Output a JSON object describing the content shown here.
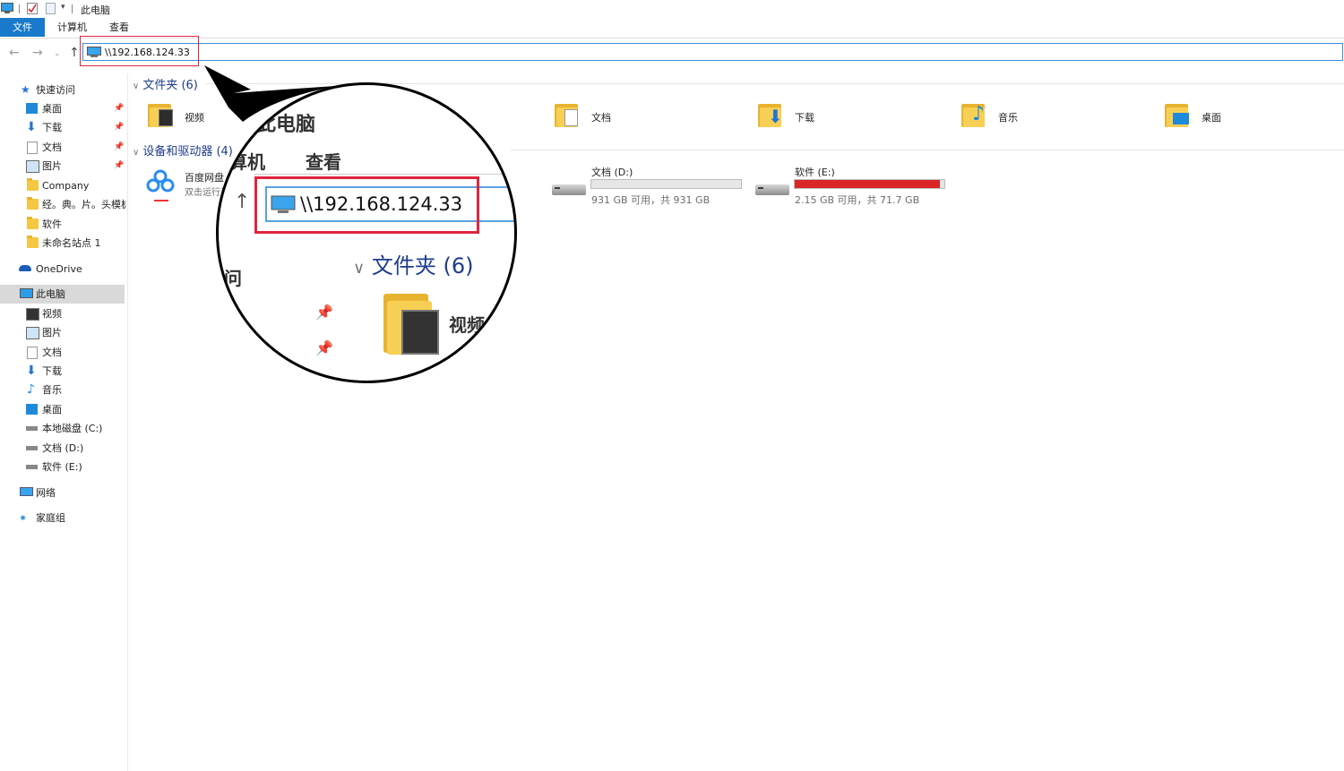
{
  "window": {
    "title": "此电脑"
  },
  "ribbon": {
    "tabs": [
      "文件",
      "计算机",
      "查看"
    ]
  },
  "address": {
    "path": "\\\\192.168.124.33"
  },
  "nav_pane": {
    "quick_access": "快速访问",
    "quick_items": [
      {
        "label": "桌面",
        "pinned": true
      },
      {
        "label": "下载",
        "pinned": true
      },
      {
        "label": "文档",
        "pinned": true
      },
      {
        "label": "图片",
        "pinned": true
      },
      {
        "label": "Company",
        "pinned": false
      },
      {
        "label": "经。典。片。头模板",
        "pinned": false
      },
      {
        "label": "软件",
        "pinned": false
      },
      {
        "label": "未命名站点 1",
        "pinned": false
      }
    ],
    "onedrive": "OneDrive",
    "this_pc": "此电脑",
    "pc_items": [
      "视频",
      "图片",
      "文档",
      "下载",
      "音乐",
      "桌面",
      "本地磁盘 (C:)",
      "文档 (D:)",
      "软件 (E:)"
    ],
    "network": "网络",
    "homegroup": "家庭组"
  },
  "main": {
    "folders_header": "文件夹 (6)",
    "folders": [
      "视频",
      "文档",
      "下载",
      "音乐",
      "桌面"
    ],
    "devices_header": "设备和驱动器 (4)",
    "baidu": {
      "name": "百度网盘",
      "sub": "双击运行百度网盘"
    },
    "drives": [
      {
        "name": "文档 (D:)",
        "free": "931 GB 可用，共 931 GB",
        "used_fraction": 0.0,
        "color": "#26a0da"
      },
      {
        "name": "软件 (E:)",
        "free": "2.15 GB 可用，共 71.7 GB",
        "used_fraction": 0.97,
        "color": "#da2626"
      }
    ]
  },
  "magnifier": {
    "title": "此电脑",
    "tab_computer": "计算机",
    "tab_view": "查看",
    "address": "\\\\192.168.124.33",
    "folders_header": "文件夹 (6)",
    "folder_label": "视频",
    "side_text": "问"
  }
}
